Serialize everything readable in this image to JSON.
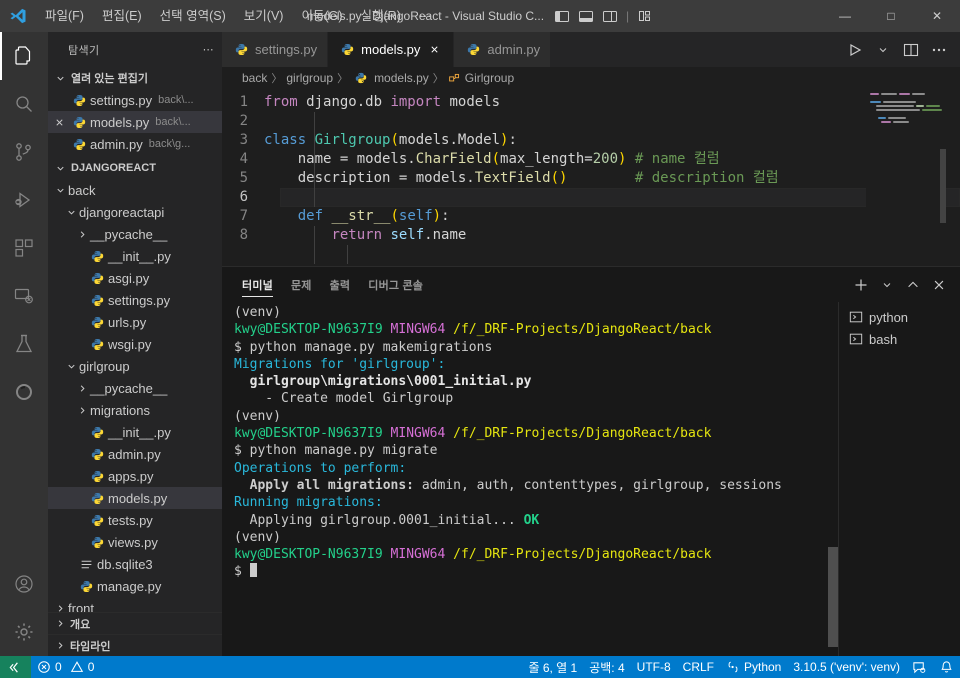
{
  "titlebar": {
    "logo_icon": "vscode-logo-icon",
    "menu": [
      {
        "label": "파일(F)",
        "name": "menu-file"
      },
      {
        "label": "편집(E)",
        "name": "menu-edit"
      },
      {
        "label": "선택 영역(S)",
        "name": "menu-selection"
      },
      {
        "label": "보기(V)",
        "name": "menu-view"
      },
      {
        "label": "이동(G)",
        "name": "menu-go"
      },
      {
        "label": "실행(R)",
        "name": "menu-run"
      },
      {
        "label": "⋯",
        "name": "menu-more"
      }
    ],
    "title": "models.py - DjangoReact - Visual Studio C...",
    "layout_icons": [
      "toggle-primary-sidebar-icon",
      "toggle-panel-icon",
      "toggle-secondary-sidebar-icon",
      "customize-layout-icon"
    ],
    "window_controls": {
      "minimize": "—",
      "maximize": "□",
      "close": "✕"
    }
  },
  "activitybar": {
    "items": [
      {
        "name": "explorer",
        "icon": "files-icon",
        "active": true
      },
      {
        "name": "search",
        "icon": "search-icon",
        "active": false
      },
      {
        "name": "source-control",
        "icon": "source-control-icon",
        "active": false
      },
      {
        "name": "run-and-debug",
        "icon": "debug-icon",
        "active": false
      },
      {
        "name": "extensions",
        "icon": "extensions-icon",
        "active": false
      },
      {
        "name": "remote-explorer",
        "icon": "remote-explorer-icon",
        "active": false
      },
      {
        "name": "testing",
        "icon": "beaker-icon",
        "active": false
      },
      {
        "name": "anaconda",
        "icon": "circle-icon",
        "active": false
      }
    ],
    "bottom": [
      {
        "name": "accounts",
        "icon": "account-icon"
      },
      {
        "name": "manage-settings",
        "icon": "gear-icon"
      }
    ]
  },
  "sidebar": {
    "title": "탐색기",
    "more_actions": "⋯",
    "open_editors": {
      "label": "열려 있는 편집기",
      "expanded": true,
      "items": [
        {
          "name": "settings.py",
          "hint": "back\\...",
          "selected": false,
          "closable": false
        },
        {
          "name": "models.py",
          "hint": "back\\...",
          "selected": true,
          "closable": true
        },
        {
          "name": "admin.py",
          "hint": "back\\g...",
          "selected": false,
          "closable": false
        }
      ]
    },
    "project": {
      "label": "DJANGOREACT",
      "expanded": true,
      "tree": [
        {
          "label": "back",
          "type": "folder",
          "open": true,
          "depth": 1
        },
        {
          "label": "djangoreactapi",
          "type": "folder",
          "open": true,
          "depth": 2
        },
        {
          "label": "__pycache__",
          "type": "folder",
          "open": false,
          "depth": 3
        },
        {
          "label": "__init__.py",
          "type": "python",
          "depth": 3
        },
        {
          "label": "asgi.py",
          "type": "python",
          "depth": 3
        },
        {
          "label": "settings.py",
          "type": "python",
          "depth": 3
        },
        {
          "label": "urls.py",
          "type": "python",
          "depth": 3
        },
        {
          "label": "wsgi.py",
          "type": "python",
          "depth": 3
        },
        {
          "label": "girlgroup",
          "type": "folder",
          "open": true,
          "depth": 2
        },
        {
          "label": "__pycache__",
          "type": "folder",
          "open": false,
          "depth": 3
        },
        {
          "label": "migrations",
          "type": "folder",
          "open": false,
          "depth": 3
        },
        {
          "label": "__init__.py",
          "type": "python",
          "depth": 3
        },
        {
          "label": "admin.py",
          "type": "python",
          "depth": 3
        },
        {
          "label": "apps.py",
          "type": "python",
          "depth": 3
        },
        {
          "label": "models.py",
          "type": "python",
          "depth": 3,
          "selected": true
        },
        {
          "label": "tests.py",
          "type": "python",
          "depth": 3
        },
        {
          "label": "views.py",
          "type": "python",
          "depth": 3
        },
        {
          "label": "db.sqlite3",
          "type": "database",
          "depth": 2
        },
        {
          "label": "manage.py",
          "type": "python",
          "depth": 2
        },
        {
          "label": "front",
          "type": "folder",
          "open": false,
          "depth": 1
        }
      ]
    },
    "sections": [
      {
        "label": "개요",
        "expanded": false
      },
      {
        "label": "타임라인",
        "expanded": false
      }
    ]
  },
  "editor": {
    "tabs": [
      {
        "label": "settings.py",
        "active": false,
        "closable": false
      },
      {
        "label": "models.py",
        "active": true,
        "closable": true
      },
      {
        "label": "admin.py",
        "active": false,
        "closable": false
      }
    ],
    "tab_actions": [
      "run-python-file-icon",
      "run-dropdown-icon",
      "split-editor-icon",
      "more-actions-icon"
    ],
    "breadcrumbs": [
      "back",
      "girlgroup",
      "models.py",
      "Girlgroup"
    ],
    "lines": [
      {
        "n": "1",
        "text": "from django.db import models"
      },
      {
        "n": "2",
        "text": ""
      },
      {
        "n": "3",
        "text": "class Girlgroup(models.Model):"
      },
      {
        "n": "4",
        "text": "    name = models.CharField(max_length=200) # name 컬럼"
      },
      {
        "n": "5",
        "text": "    description = models.TextField()        # description 컬럼"
      },
      {
        "n": "6",
        "text": "",
        "active": true
      },
      {
        "n": "7",
        "text": "    def __str__(self):"
      },
      {
        "n": "8",
        "text": "        return self.name"
      }
    ]
  },
  "panel": {
    "tabs": [
      {
        "label": "터미널",
        "active": true
      },
      {
        "label": "문제",
        "active": false
      },
      {
        "label": "출력",
        "active": false
      },
      {
        "label": "디버그 콘솔",
        "active": false
      }
    ],
    "actions": [
      "new-terminal-icon",
      "terminal-dropdown-icon",
      "maximize-panel-icon",
      "close-panel-icon"
    ],
    "terminal_lines": [
      [
        {
          "t": "(venv)",
          "c": "plain"
        }
      ],
      [
        {
          "t": "kwy@DESKTOP-N9637I9",
          "c": "green"
        },
        {
          "t": " ",
          "c": "plain"
        },
        {
          "t": "MINGW64",
          "c": "magenta"
        },
        {
          "t": " ",
          "c": "plain"
        },
        {
          "t": "/f/_DRF-Projects/DjangoReact/back",
          "c": "yellow"
        }
      ],
      [
        {
          "t": "$ python manage.py makemigrations",
          "c": "plain"
        }
      ],
      [
        {
          "t": "Migrations for 'girlgroup':",
          "c": "cyan"
        }
      ],
      [
        {
          "t": "  girlgroup\\migrations\\0001_initial.py",
          "c": "white-b"
        }
      ],
      [
        {
          "t": "    - Create model Girlgroup",
          "c": "plain"
        }
      ],
      [
        {
          "t": "(venv)",
          "c": "plain"
        }
      ],
      [
        {
          "t": "kwy@DESKTOP-N9637I9",
          "c": "green"
        },
        {
          "t": " ",
          "c": "plain"
        },
        {
          "t": "MINGW64",
          "c": "magenta"
        },
        {
          "t": " ",
          "c": "plain"
        },
        {
          "t": "/f/_DRF-Projects/DjangoReact/back",
          "c": "yellow"
        }
      ],
      [
        {
          "t": "$ python manage.py migrate",
          "c": "plain"
        }
      ],
      [
        {
          "t": "Operations to perform:",
          "c": "cyan"
        }
      ],
      [
        {
          "t": "  Apply all migrations:",
          "c": "bold"
        },
        {
          "t": " admin, auth, contenttypes, girlgroup, sessions",
          "c": "plain"
        }
      ],
      [
        {
          "t": "Running migrations:",
          "c": "cyan"
        }
      ],
      [
        {
          "t": "  Applying girlgroup.0001_initial... ",
          "c": "plain"
        },
        {
          "t": "OK",
          "c": "ok"
        }
      ],
      [
        {
          "t": "(venv)",
          "c": "plain"
        }
      ],
      [
        {
          "t": "kwy@DESKTOP-N9637I9",
          "c": "green"
        },
        {
          "t": " ",
          "c": "plain"
        },
        {
          "t": "MINGW64",
          "c": "magenta"
        },
        {
          "t": " ",
          "c": "plain"
        },
        {
          "t": "/f/_DRF-Projects/DjangoReact/back",
          "c": "yellow"
        }
      ],
      [
        {
          "t": "$ ",
          "c": "plain"
        },
        {
          "t": "",
          "c": "cursor"
        }
      ]
    ],
    "terminal_list": [
      {
        "label": "python",
        "icon": "terminal-icon"
      },
      {
        "label": "bash",
        "icon": "terminal-icon"
      }
    ]
  },
  "statusbar": {
    "remote_icon": "remote-host-icon",
    "errors": "0",
    "warnings": "0",
    "right_items": [
      {
        "label": "줄 6, 열 1",
        "name": "cursor-position"
      },
      {
        "label": "공백: 4",
        "name": "indentation"
      },
      {
        "label": "UTF-8",
        "name": "encoding"
      },
      {
        "label": "CRLF",
        "name": "eol"
      },
      {
        "label": "Python",
        "name": "language-mode"
      },
      {
        "label": "3.10.5 ('venv': venv)",
        "name": "python-interpreter"
      }
    ],
    "feedback_icon": "feedback-icon",
    "bell_icon": "bell-icon"
  },
  "colors": {
    "accent": "#007acc",
    "titlebar_bg": "#3c3c3c",
    "activitybar_bg": "#333333",
    "sidebar_bg": "#252526",
    "editor_bg": "#1e1e1e",
    "panel_bg": "#181818",
    "remote_green": "#16825d"
  }
}
